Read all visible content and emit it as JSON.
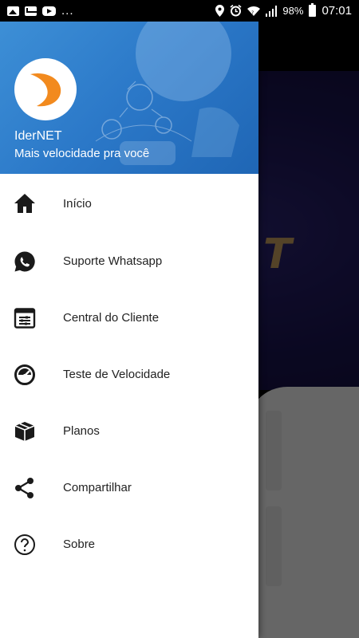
{
  "status_bar": {
    "left_icons": [
      "image-icon",
      "mail-icon",
      "youtube-icon"
    ],
    "more": "...",
    "right_icons": [
      "location-icon",
      "alarm-icon",
      "wifi-icon",
      "signal-icon"
    ],
    "battery_percent": "98%",
    "time": "07:01"
  },
  "drawer": {
    "header": {
      "app_name": "IderNET",
      "tagline": "Mais velocidade pra você"
    },
    "items": [
      {
        "label": "Início",
        "icon": "home-icon"
      },
      {
        "label": "Suporte Whatsapp",
        "icon": "whatsapp-icon"
      },
      {
        "label": "Central do Cliente",
        "icon": "customer-center-icon"
      },
      {
        "label": "Teste de Velocidade",
        "icon": "speedometer-icon"
      },
      {
        "label": "Planos",
        "icon": "package-icon"
      },
      {
        "label": "Compartilhar",
        "icon": "share-icon"
      },
      {
        "label": "Sobre",
        "icon": "help-icon"
      }
    ]
  },
  "background_app": {
    "logo_fragment": "T"
  },
  "colors": {
    "header_blue": "#2b78c8",
    "logo_orange": "#f28a1e"
  }
}
